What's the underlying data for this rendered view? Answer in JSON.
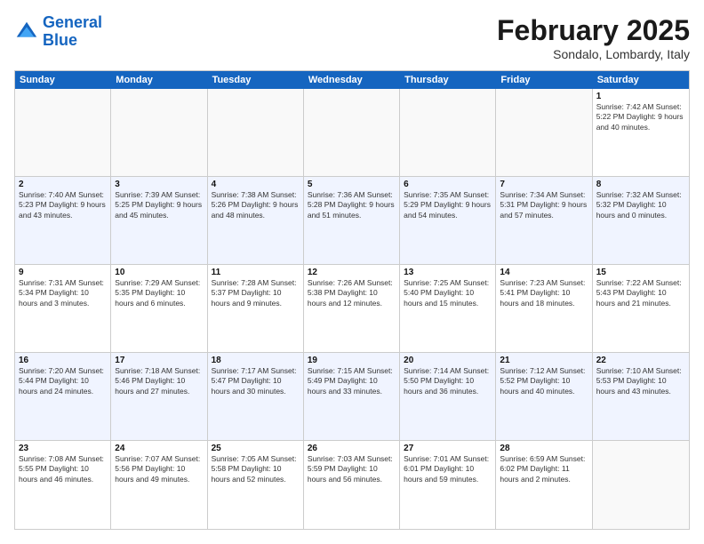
{
  "header": {
    "logo_line1": "General",
    "logo_line2": "Blue",
    "month": "February 2025",
    "location": "Sondalo, Lombardy, Italy"
  },
  "days": [
    "Sunday",
    "Monday",
    "Tuesday",
    "Wednesday",
    "Thursday",
    "Friday",
    "Saturday"
  ],
  "weeks": [
    [
      {
        "day": "",
        "info": ""
      },
      {
        "day": "",
        "info": ""
      },
      {
        "day": "",
        "info": ""
      },
      {
        "day": "",
        "info": ""
      },
      {
        "day": "",
        "info": ""
      },
      {
        "day": "",
        "info": ""
      },
      {
        "day": "1",
        "info": "Sunrise: 7:42 AM\nSunset: 5:22 PM\nDaylight: 9 hours and 40 minutes."
      }
    ],
    [
      {
        "day": "2",
        "info": "Sunrise: 7:40 AM\nSunset: 5:23 PM\nDaylight: 9 hours and 43 minutes."
      },
      {
        "day": "3",
        "info": "Sunrise: 7:39 AM\nSunset: 5:25 PM\nDaylight: 9 hours and 45 minutes."
      },
      {
        "day": "4",
        "info": "Sunrise: 7:38 AM\nSunset: 5:26 PM\nDaylight: 9 hours and 48 minutes."
      },
      {
        "day": "5",
        "info": "Sunrise: 7:36 AM\nSunset: 5:28 PM\nDaylight: 9 hours and 51 minutes."
      },
      {
        "day": "6",
        "info": "Sunrise: 7:35 AM\nSunset: 5:29 PM\nDaylight: 9 hours and 54 minutes."
      },
      {
        "day": "7",
        "info": "Sunrise: 7:34 AM\nSunset: 5:31 PM\nDaylight: 9 hours and 57 minutes."
      },
      {
        "day": "8",
        "info": "Sunrise: 7:32 AM\nSunset: 5:32 PM\nDaylight: 10 hours and 0 minutes."
      }
    ],
    [
      {
        "day": "9",
        "info": "Sunrise: 7:31 AM\nSunset: 5:34 PM\nDaylight: 10 hours and 3 minutes."
      },
      {
        "day": "10",
        "info": "Sunrise: 7:29 AM\nSunset: 5:35 PM\nDaylight: 10 hours and 6 minutes."
      },
      {
        "day": "11",
        "info": "Sunrise: 7:28 AM\nSunset: 5:37 PM\nDaylight: 10 hours and 9 minutes."
      },
      {
        "day": "12",
        "info": "Sunrise: 7:26 AM\nSunset: 5:38 PM\nDaylight: 10 hours and 12 minutes."
      },
      {
        "day": "13",
        "info": "Sunrise: 7:25 AM\nSunset: 5:40 PM\nDaylight: 10 hours and 15 minutes."
      },
      {
        "day": "14",
        "info": "Sunrise: 7:23 AM\nSunset: 5:41 PM\nDaylight: 10 hours and 18 minutes."
      },
      {
        "day": "15",
        "info": "Sunrise: 7:22 AM\nSunset: 5:43 PM\nDaylight: 10 hours and 21 minutes."
      }
    ],
    [
      {
        "day": "16",
        "info": "Sunrise: 7:20 AM\nSunset: 5:44 PM\nDaylight: 10 hours and 24 minutes."
      },
      {
        "day": "17",
        "info": "Sunrise: 7:18 AM\nSunset: 5:46 PM\nDaylight: 10 hours and 27 minutes."
      },
      {
        "day": "18",
        "info": "Sunrise: 7:17 AM\nSunset: 5:47 PM\nDaylight: 10 hours and 30 minutes."
      },
      {
        "day": "19",
        "info": "Sunrise: 7:15 AM\nSunset: 5:49 PM\nDaylight: 10 hours and 33 minutes."
      },
      {
        "day": "20",
        "info": "Sunrise: 7:14 AM\nSunset: 5:50 PM\nDaylight: 10 hours and 36 minutes."
      },
      {
        "day": "21",
        "info": "Sunrise: 7:12 AM\nSunset: 5:52 PM\nDaylight: 10 hours and 40 minutes."
      },
      {
        "day": "22",
        "info": "Sunrise: 7:10 AM\nSunset: 5:53 PM\nDaylight: 10 hours and 43 minutes."
      }
    ],
    [
      {
        "day": "23",
        "info": "Sunrise: 7:08 AM\nSunset: 5:55 PM\nDaylight: 10 hours and 46 minutes."
      },
      {
        "day": "24",
        "info": "Sunrise: 7:07 AM\nSunset: 5:56 PM\nDaylight: 10 hours and 49 minutes."
      },
      {
        "day": "25",
        "info": "Sunrise: 7:05 AM\nSunset: 5:58 PM\nDaylight: 10 hours and 52 minutes."
      },
      {
        "day": "26",
        "info": "Sunrise: 7:03 AM\nSunset: 5:59 PM\nDaylight: 10 hours and 56 minutes."
      },
      {
        "day": "27",
        "info": "Sunrise: 7:01 AM\nSunset: 6:01 PM\nDaylight: 10 hours and 59 minutes."
      },
      {
        "day": "28",
        "info": "Sunrise: 6:59 AM\nSunset: 6:02 PM\nDaylight: 11 hours and 2 minutes."
      },
      {
        "day": "",
        "info": ""
      }
    ]
  ]
}
